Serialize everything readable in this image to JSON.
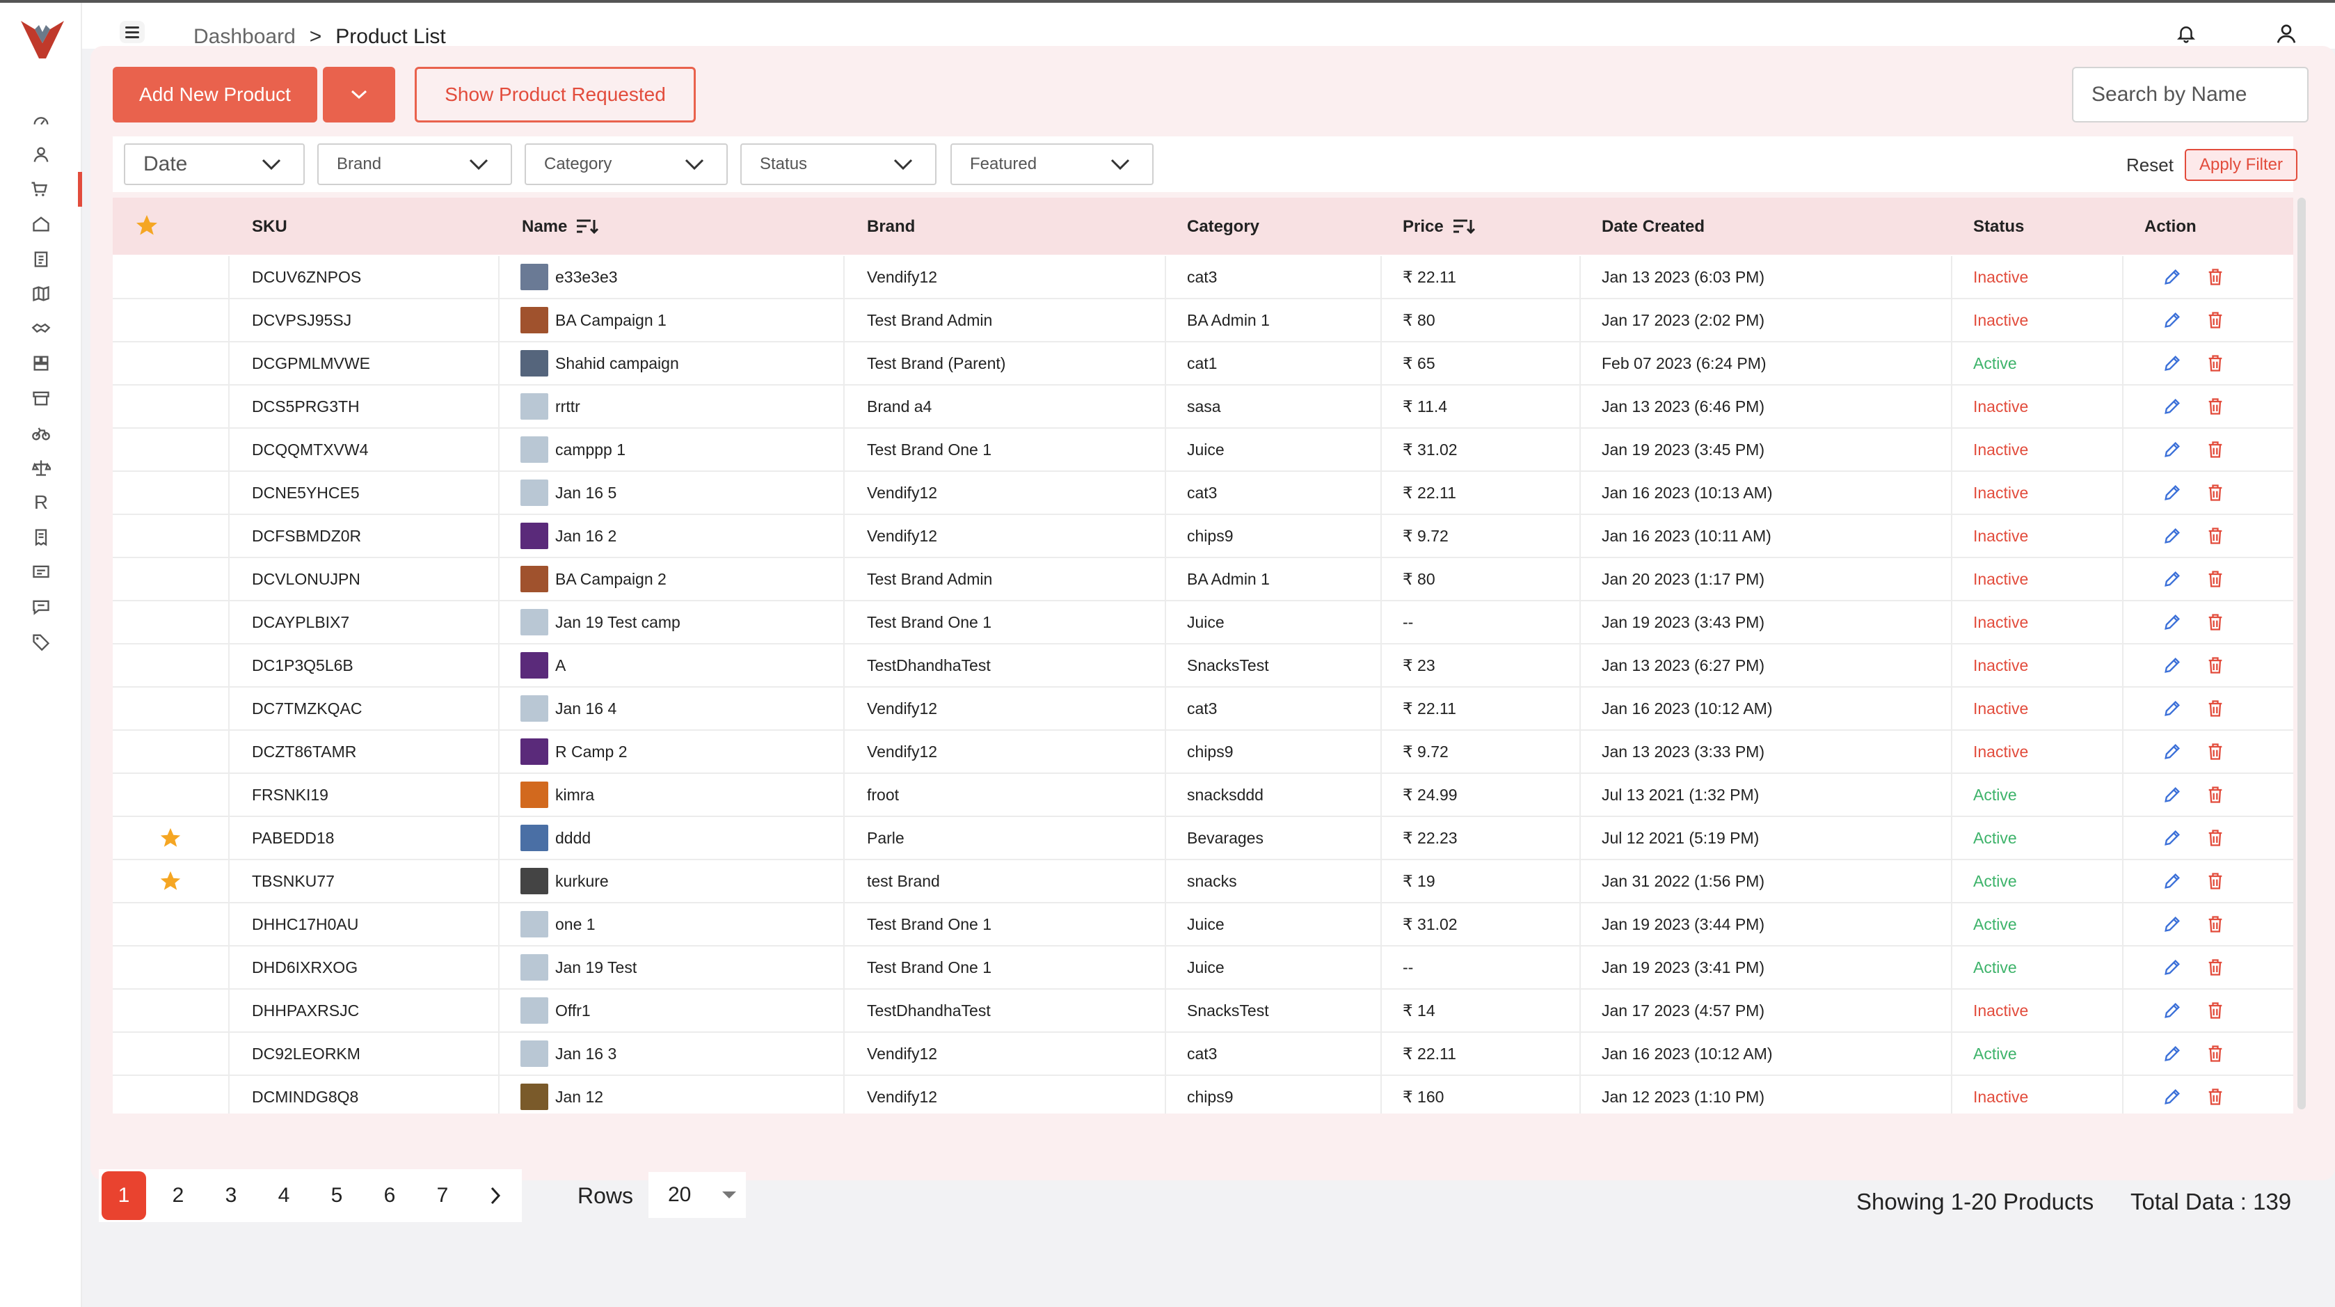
{
  "breadcrumb": {
    "parent": "Dashboard",
    "separator": ">",
    "current": "Product List"
  },
  "toolbar": {
    "add_label": "Add New Product",
    "requested_label": "Show Product Requested"
  },
  "search": {
    "placeholder": "Search by Name"
  },
  "filters": {
    "date": "Date",
    "brand": "Brand",
    "category": "Category",
    "status": "Status",
    "featured": "Featured",
    "reset": "Reset",
    "apply": "Apply Filter"
  },
  "table": {
    "headers": {
      "sku": "SKU",
      "name": "Name",
      "brand": "Brand",
      "category": "Category",
      "price": "Price",
      "date": "Date Created",
      "status": "Status",
      "action": "Action"
    },
    "rows": [
      {
        "star": false,
        "sku": "DCUV6ZNPOS",
        "name": "e33e3e3",
        "thumb": "#6a7a95",
        "brand": "Vendify12",
        "category": "cat3",
        "price": "₹ 22.11",
        "date": "Jan 13 2023 (6:03 PM)",
        "status": "Inactive"
      },
      {
        "star": false,
        "sku": "DCVPSJ95SJ",
        "name": "BA Campaign 1",
        "thumb": "#a0522d",
        "brand": "Test Brand Admin",
        "category": "BA Admin 1",
        "price": "₹ 80",
        "date": "Jan 17 2023 (2:02 PM)",
        "status": "Inactive"
      },
      {
        "star": false,
        "sku": "DCGPMLMVWE",
        "name": "Shahid campaign",
        "thumb": "#55657c",
        "brand": "Test Brand (Parent)",
        "category": "cat1",
        "price": "₹ 65",
        "date": "Feb 07 2023 (6:24 PM)",
        "status": "Active"
      },
      {
        "star": false,
        "sku": "DCS5PRG3TH",
        "name": "rrttr",
        "thumb": "#b9c7d4",
        "brand": "Brand a4",
        "category": "sasa",
        "price": "₹ 11.4",
        "date": "Jan 13 2023 (6:46 PM)",
        "status": "Inactive"
      },
      {
        "star": false,
        "sku": "DCQQMTXVW4",
        "name": "camppp 1",
        "thumb": "#b9c7d4",
        "brand": "Test Brand One 1",
        "category": "Juice",
        "price": "₹ 31.02",
        "date": "Jan 19 2023 (3:45 PM)",
        "status": "Inactive"
      },
      {
        "star": false,
        "sku": "DCNE5YHCE5",
        "name": "Jan 16 5",
        "thumb": "#b9c7d4",
        "brand": "Vendify12",
        "category": "cat3",
        "price": "₹ 22.11",
        "date": "Jan 16 2023 (10:13 AM)",
        "status": "Inactive"
      },
      {
        "star": false,
        "sku": "DCFSBMDZ0R",
        "name": "Jan 16 2",
        "thumb": "#5a2a7a",
        "brand": "Vendify12",
        "category": "chips9",
        "price": "₹ 9.72",
        "date": "Jan 16 2023 (10:11 AM)",
        "status": "Inactive"
      },
      {
        "star": false,
        "sku": "DCVLONUJPN",
        "name": "BA Campaign 2",
        "thumb": "#a0522d",
        "brand": "Test Brand Admin",
        "category": "BA Admin 1",
        "price": "₹ 80",
        "date": "Jan 20 2023 (1:17 PM)",
        "status": "Inactive"
      },
      {
        "star": false,
        "sku": "DCAYPLBIX7",
        "name": "Jan 19 Test camp",
        "thumb": "#b9c7d4",
        "brand": "Test Brand One 1",
        "category": "Juice",
        "price": "--",
        "date": "Jan 19 2023 (3:43 PM)",
        "status": "Inactive"
      },
      {
        "star": false,
        "sku": "DC1P3Q5L6B",
        "name": "A",
        "thumb": "#5a2a7a",
        "brand": "TestDhandhaTest",
        "category": "SnacksTest",
        "price": "₹ 23",
        "date": "Jan 13 2023 (6:27 PM)",
        "status": "Inactive"
      },
      {
        "star": false,
        "sku": "DC7TMZKQAC",
        "name": "Jan 16 4",
        "thumb": "#b9c7d4",
        "brand": "Vendify12",
        "category": "cat3",
        "price": "₹ 22.11",
        "date": "Jan 16 2023 (10:12 AM)",
        "status": "Inactive"
      },
      {
        "star": false,
        "sku": "DCZT86TAMR",
        "name": "R Camp 2",
        "thumb": "#5a2a7a",
        "brand": "Vendify12",
        "category": "chips9",
        "price": "₹ 9.72",
        "date": "Jan 13 2023 (3:33 PM)",
        "status": "Inactive"
      },
      {
        "star": false,
        "sku": "FRSNKI19",
        "name": "kimra",
        "thumb": "#d2691e",
        "brand": "froot",
        "category": "snacksddd",
        "price": "₹ 24.99",
        "date": "Jul 13 2021 (1:32 PM)",
        "status": "Active"
      },
      {
        "star": true,
        "sku": "PABEDD18",
        "name": "dddd",
        "thumb": "#4a6fa5",
        "brand": "Parle",
        "category": "Bevarages",
        "price": "₹ 22.23",
        "date": "Jul 12 2021 (5:19 PM)",
        "status": "Active"
      },
      {
        "star": true,
        "sku": "TBSNKU77",
        "name": "kurkure",
        "thumb": "#444444",
        "brand": "test Brand",
        "category": "snacks",
        "price": "₹ 19",
        "date": "Jan 31 2022 (1:56 PM)",
        "status": "Active"
      },
      {
        "star": false,
        "sku": "DHHC17H0AU",
        "name": "one 1",
        "thumb": "#b9c7d4",
        "brand": "Test Brand One 1",
        "category": "Juice",
        "price": "₹ 31.02",
        "date": "Jan 19 2023 (3:44 PM)",
        "status": "Active"
      },
      {
        "star": false,
        "sku": "DHD6IXRXOG",
        "name": "Jan 19 Test",
        "thumb": "#b9c7d4",
        "brand": "Test Brand One 1",
        "category": "Juice",
        "price": "--",
        "date": "Jan 19 2023 (3:41 PM)",
        "status": "Active"
      },
      {
        "star": false,
        "sku": "DHHPAXRSJC",
        "name": "Offr1",
        "thumb": "#b9c7d4",
        "brand": "TestDhandhaTest",
        "category": "SnacksTest",
        "price": "₹ 14",
        "date": "Jan 17 2023 (4:57 PM)",
        "status": "Inactive"
      },
      {
        "star": false,
        "sku": "DC92LEORKM",
        "name": "Jan 16 3",
        "thumb": "#b9c7d4",
        "brand": "Vendify12",
        "category": "cat3",
        "price": "₹ 22.11",
        "date": "Jan 16 2023 (10:12 AM)",
        "status": "Active"
      },
      {
        "star": false,
        "sku": "DCMINDG8Q8",
        "name": "Jan 12",
        "thumb": "#7a5a2a",
        "brand": "Vendify12",
        "category": "chips9",
        "price": "₹ 160",
        "date": "Jan 12 2023 (1:10 PM)",
        "status": "Inactive"
      }
    ]
  },
  "pagination": {
    "pages": [
      "1",
      "2",
      "3",
      "4",
      "5",
      "6",
      "7"
    ],
    "current": "1"
  },
  "rows_per_page": {
    "label": "Rows",
    "value": "20"
  },
  "summary": {
    "showing": "Showing 1-20 Products",
    "total": "Total Data : 139"
  },
  "colors": {
    "accent": "#e9624d",
    "active": "#3db36a",
    "inactive": "#e24c3c",
    "star": "#f5a623",
    "edit": "#3a6fd8"
  },
  "sidebar_icons": [
    "dashboard-icon",
    "user-icon",
    "cart-icon",
    "home-icon",
    "clipboard-icon",
    "map-icon",
    "handshake-icon",
    "store-icon",
    "shop-icon",
    "bike-icon",
    "scale-icon",
    "r-icon",
    "receipt-icon",
    "message-icon",
    "chat-icon",
    "tag-icon"
  ],
  "sidebar_r_letter": "R"
}
